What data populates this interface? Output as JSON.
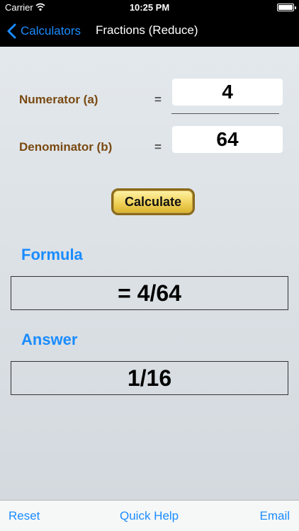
{
  "status_bar": {
    "carrier": "Carrier",
    "time": "10:25 PM",
    "battery_level": 1.0
  },
  "nav": {
    "back_label": "Calculators",
    "title": "Fractions (Reduce)"
  },
  "inputs": {
    "numerator": {
      "label": "Numerator (a)",
      "equals": "=",
      "value": "4"
    },
    "denominator": {
      "label": "Denominator (b)",
      "equals": "=",
      "value": "64"
    }
  },
  "calculate_label": "Calculate",
  "formula": {
    "title": "Formula",
    "value": "= 4/64"
  },
  "answer": {
    "title": "Answer",
    "value": "1/16"
  },
  "toolbar": {
    "reset_label": "Reset",
    "quick_help_label": "Quick Help",
    "email_label": "Email"
  },
  "colors": {
    "accent": "#1a8cff",
    "label_brown": "#7a4a12",
    "button_gold": "#f0d25a"
  }
}
